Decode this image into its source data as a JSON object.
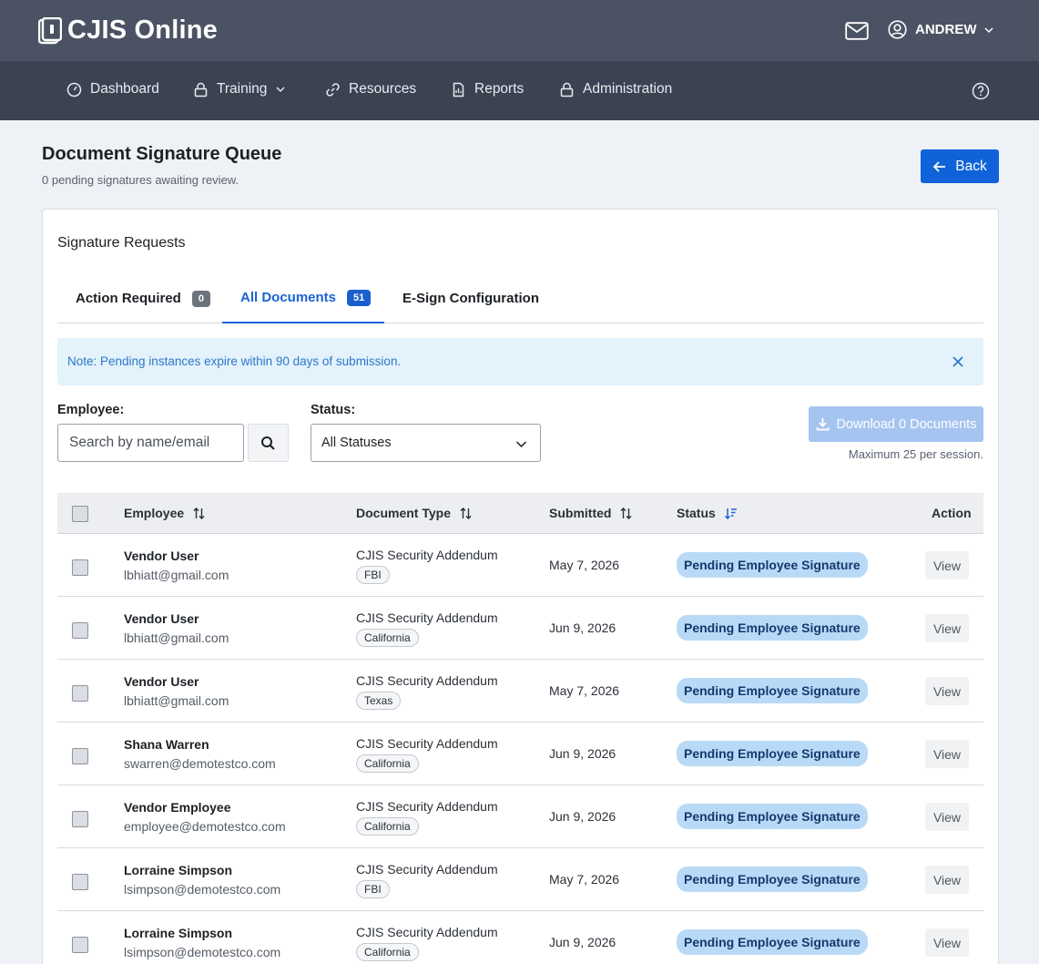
{
  "app": {
    "title": "CJIS Online",
    "user": "ANDREW"
  },
  "nav": {
    "items": [
      {
        "label": "Dashboard",
        "icon": "dashboard-icon"
      },
      {
        "label": "Training",
        "icon": "lock-icon"
      },
      {
        "label": "Resources",
        "icon": "link-icon"
      },
      {
        "label": "Reports",
        "icon": "report-icon"
      },
      {
        "label": "Administration",
        "icon": "lock-icon"
      }
    ]
  },
  "page": {
    "title": "Document Signature Queue",
    "subtitle": "0 pending signatures awaiting review.",
    "back_label": "Back"
  },
  "card": {
    "title": "Signature Requests",
    "tabs": [
      {
        "label": "Action Required",
        "count": "0"
      },
      {
        "label": "All Documents",
        "count": "51"
      },
      {
        "label": "E-Sign Configuration"
      }
    ],
    "note": "Note: Pending instances expire within 90 days of submission."
  },
  "filters": {
    "employee_label": "Employee:",
    "search_placeholder": "Search by name/email",
    "status_label": "Status:",
    "status_value": "All Statuses",
    "download_label": "Download 0 Documents",
    "download_note": "Maximum 25 per session."
  },
  "table": {
    "headers": {
      "employee": "Employee",
      "doc_type": "Document Type",
      "submitted": "Submitted",
      "status": "Status",
      "action": "Action"
    },
    "rows": [
      {
        "name": "Vendor User",
        "email": "lbhiatt@gmail.com",
        "doc": "CJIS Security Addendum",
        "tag": "FBI",
        "date": "May 7, 2026",
        "status": "Pending Employee Signature",
        "action": "View"
      },
      {
        "name": "Vendor User",
        "email": "lbhiatt@gmail.com",
        "doc": "CJIS Security Addendum",
        "tag": "California",
        "date": "Jun 9, 2026",
        "status": "Pending Employee Signature",
        "action": "View"
      },
      {
        "name": "Vendor User",
        "email": "lbhiatt@gmail.com",
        "doc": "CJIS Security Addendum",
        "tag": "Texas",
        "date": "May 7, 2026",
        "status": "Pending Employee Signature",
        "action": "View"
      },
      {
        "name": "Shana Warren",
        "email": "swarren@demotestco.com",
        "doc": "CJIS Security Addendum",
        "tag": "California",
        "date": "Jun 9, 2026",
        "status": "Pending Employee Signature",
        "action": "View"
      },
      {
        "name": "Vendor Employee",
        "email": "employee@demotestco.com",
        "doc": "CJIS Security Addendum",
        "tag": "California",
        "date": "Jun 9, 2026",
        "status": "Pending Employee Signature",
        "action": "View"
      },
      {
        "name": "Lorraine Simpson",
        "email": "lsimpson@demotestco.com",
        "doc": "CJIS Security Addendum",
        "tag": "FBI",
        "date": "May 7, 2026",
        "status": "Pending Employee Signature",
        "action": "View"
      },
      {
        "name": "Lorraine Simpson",
        "email": "lsimpson@demotestco.com",
        "doc": "CJIS Security Addendum",
        "tag": "California",
        "date": "Jun 9, 2026",
        "status": "Pending Employee Signature",
        "action": "View"
      }
    ]
  }
}
